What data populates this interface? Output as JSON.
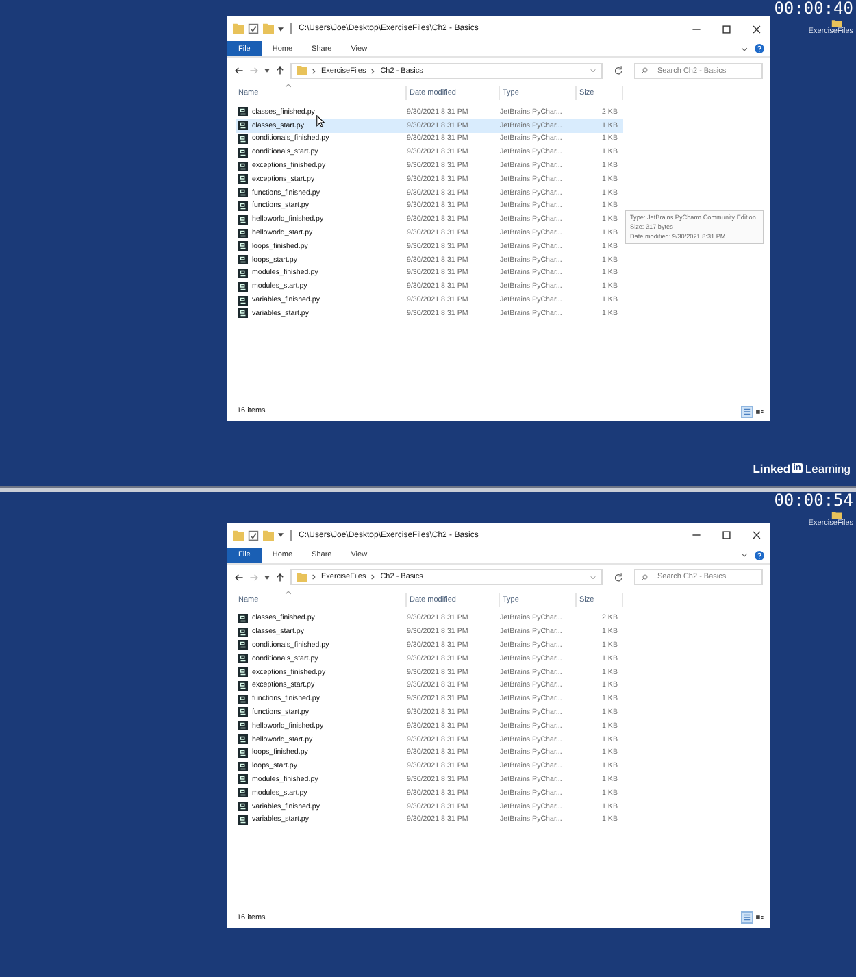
{
  "frames": [
    {
      "timestamp": "00:00:40",
      "desktop_icon_label": "ExerciseFiles",
      "mouse_pointer": true,
      "window": {
        "title": "C:\\Users\\Joe\\Desktop\\ExerciseFiles\\Ch2 - Basics",
        "ribbon_tabs": [
          {
            "label": "File",
            "selected": true
          },
          {
            "label": "Home",
            "selected": false
          },
          {
            "label": "Share",
            "selected": false
          },
          {
            "label": "View",
            "selected": false
          }
        ],
        "breadcrumbs": [
          "ExerciseFiles",
          "Ch2 - Basics"
        ],
        "search": {
          "placeholder": "Search Ch2 - Basics"
        },
        "columns": [
          "Name",
          "Date modified",
          "Type",
          "Size"
        ],
        "rows": [
          {
            "name": "classes_finished.py",
            "date": "9/30/2021 8:31 PM",
            "type": "JetBrains PyChar...",
            "size": "2 KB",
            "selected": false
          },
          {
            "name": "classes_start.py",
            "date": "9/30/2021 8:31 PM",
            "type": "JetBrains PyChar...",
            "size": "1 KB",
            "selected": true
          },
          {
            "name": "conditionals_finished.py",
            "date": "9/30/2021 8:31 PM",
            "type": "JetBrains PyChar...",
            "size": "1 KB",
            "selected": false
          },
          {
            "name": "conditionals_start.py",
            "date": "9/30/2021 8:31 PM",
            "type": "JetBrains PyChar...",
            "size": "1 KB",
            "selected": false
          },
          {
            "name": "exceptions_finished.py",
            "date": "9/30/2021 8:31 PM",
            "type": "JetBrains PyChar...",
            "size": "1 KB",
            "selected": false
          },
          {
            "name": "exceptions_start.py",
            "date": "9/30/2021 8:31 PM",
            "type": "JetBrains PyChar...",
            "size": "1 KB",
            "selected": false
          },
          {
            "name": "functions_finished.py",
            "date": "9/30/2021 8:31 PM",
            "type": "JetBrains PyChar...",
            "size": "1 KB",
            "selected": false
          },
          {
            "name": "functions_start.py",
            "date": "9/30/2021 8:31 PM",
            "type": "JetBrains PyChar...",
            "size": "1 KB",
            "selected": false
          },
          {
            "name": "helloworld_finished.py",
            "date": "9/30/2021 8:31 PM",
            "type": "JetBrains PyChar...",
            "size": "1 KB",
            "selected": false
          },
          {
            "name": "helloworld_start.py",
            "date": "9/30/2021 8:31 PM",
            "type": "JetBrains PyChar...",
            "size": "1 KB",
            "selected": false
          },
          {
            "name": "loops_finished.py",
            "date": "9/30/2021 8:31 PM",
            "type": "JetBrains PyChar...",
            "size": "1 KB",
            "selected": false
          },
          {
            "name": "loops_start.py",
            "date": "9/30/2021 8:31 PM",
            "type": "JetBrains PyChar...",
            "size": "1 KB",
            "selected": false
          },
          {
            "name": "modules_finished.py",
            "date": "9/30/2021 8:31 PM",
            "type": "JetBrains PyChar...",
            "size": "1 KB",
            "selected": false
          },
          {
            "name": "modules_start.py",
            "date": "9/30/2021 8:31 PM",
            "type": "JetBrains PyChar...",
            "size": "1 KB",
            "selected": false
          },
          {
            "name": "variables_finished.py",
            "date": "9/30/2021 8:31 PM",
            "type": "JetBrains PyChar...",
            "size": "1 KB",
            "selected": false
          },
          {
            "name": "variables_start.py",
            "date": "9/30/2021 8:31 PM",
            "type": "JetBrains PyChar...",
            "size": "1 KB",
            "selected": false
          }
        ],
        "tooltip": [
          "Type: JetBrains PyCharm Community Edition",
          "Size: 317 bytes",
          "Date modified: 9/30/2021 8:31 PM"
        ],
        "status": "16 items"
      },
      "branding": {
        "wordmark": "Linked",
        "badge": "in",
        "product": "Learning"
      }
    },
    {
      "timestamp": "00:00:54",
      "desktop_icon_label": "ExerciseFiles",
      "mouse_pointer": false,
      "window": {
        "title": "C:\\Users\\Joe\\Desktop\\ExerciseFiles\\Ch2 - Basics",
        "ribbon_tabs": [
          {
            "label": "File",
            "selected": true
          },
          {
            "label": "Home",
            "selected": false
          },
          {
            "label": "Share",
            "selected": false
          },
          {
            "label": "View",
            "selected": false
          }
        ],
        "breadcrumbs": [
          "ExerciseFiles",
          "Ch2 - Basics"
        ],
        "search": {
          "placeholder": "Search Ch2 - Basics"
        },
        "columns": [
          "Name",
          "Date modified",
          "Type",
          "Size"
        ],
        "rows": [
          {
            "name": "classes_finished.py",
            "date": "9/30/2021 8:31 PM",
            "type": "JetBrains PyChar...",
            "size": "2 KB",
            "selected": false
          },
          {
            "name": "classes_start.py",
            "date": "9/30/2021 8:31 PM",
            "type": "JetBrains PyChar...",
            "size": "1 KB",
            "selected": false
          },
          {
            "name": "conditionals_finished.py",
            "date": "9/30/2021 8:31 PM",
            "type": "JetBrains PyChar...",
            "size": "1 KB",
            "selected": false
          },
          {
            "name": "conditionals_start.py",
            "date": "9/30/2021 8:31 PM",
            "type": "JetBrains PyChar...",
            "size": "1 KB",
            "selected": false
          },
          {
            "name": "exceptions_finished.py",
            "date": "9/30/2021 8:31 PM",
            "type": "JetBrains PyChar...",
            "size": "1 KB",
            "selected": false
          },
          {
            "name": "exceptions_start.py",
            "date": "9/30/2021 8:31 PM",
            "type": "JetBrains PyChar...",
            "size": "1 KB",
            "selected": false
          },
          {
            "name": "functions_finished.py",
            "date": "9/30/2021 8:31 PM",
            "type": "JetBrains PyChar...",
            "size": "1 KB",
            "selected": false
          },
          {
            "name": "functions_start.py",
            "date": "9/30/2021 8:31 PM",
            "type": "JetBrains PyChar...",
            "size": "1 KB",
            "selected": false
          },
          {
            "name": "helloworld_finished.py",
            "date": "9/30/2021 8:31 PM",
            "type": "JetBrains PyChar...",
            "size": "1 KB",
            "selected": false
          },
          {
            "name": "helloworld_start.py",
            "date": "9/30/2021 8:31 PM",
            "type": "JetBrains PyChar...",
            "size": "1 KB",
            "selected": false
          },
          {
            "name": "loops_finished.py",
            "date": "9/30/2021 8:31 PM",
            "type": "JetBrains PyChar...",
            "size": "1 KB",
            "selected": false
          },
          {
            "name": "loops_start.py",
            "date": "9/30/2021 8:31 PM",
            "type": "JetBrains PyChar...",
            "size": "1 KB",
            "selected": false
          },
          {
            "name": "modules_finished.py",
            "date": "9/30/2021 8:31 PM",
            "type": "JetBrains PyChar...",
            "size": "1 KB",
            "selected": false
          },
          {
            "name": "modules_start.py",
            "date": "9/30/2021 8:31 PM",
            "type": "JetBrains PyChar...",
            "size": "1 KB",
            "selected": false
          },
          {
            "name": "variables_finished.py",
            "date": "9/30/2021 8:31 PM",
            "type": "JetBrains PyChar...",
            "size": "1 KB",
            "selected": false
          },
          {
            "name": "variables_start.py",
            "date": "9/30/2021 8:31 PM",
            "type": "JetBrains PyChar...",
            "size": "1 KB",
            "selected": false
          }
        ],
        "status": "16 items"
      }
    }
  ]
}
